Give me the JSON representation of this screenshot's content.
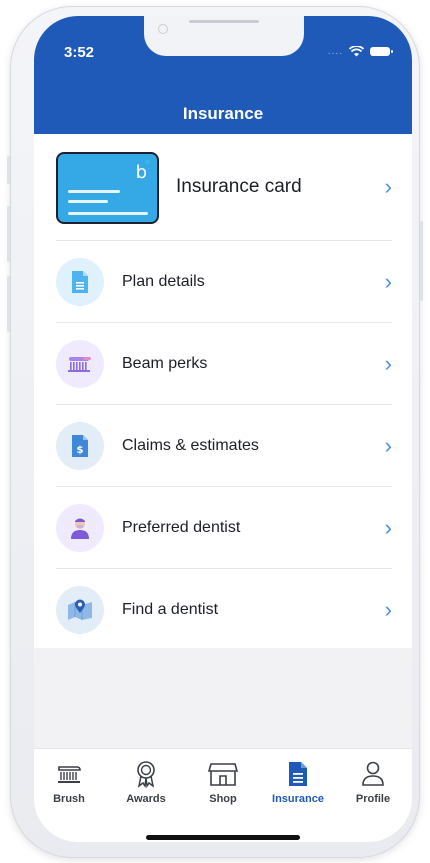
{
  "status": {
    "time": "3:52"
  },
  "header": {
    "title": "Insurance"
  },
  "card": {
    "label": "Insurance card",
    "logo_letter": "b"
  },
  "list": {
    "items": [
      {
        "label": "Plan details",
        "icon": "document-icon"
      },
      {
        "label": "Beam perks",
        "icon": "toothbrush-icon"
      },
      {
        "label": "Claims & estimates",
        "icon": "receipt-dollar-icon"
      },
      {
        "label": "Preferred dentist",
        "icon": "dentist-icon"
      },
      {
        "label": "Find a dentist",
        "icon": "map-pin-icon"
      }
    ],
    "chevron": "›"
  },
  "tabbar": {
    "tabs": [
      {
        "label": "Brush",
        "icon": "toothbrush-icon"
      },
      {
        "label": "Awards",
        "icon": "award-ribbon-icon"
      },
      {
        "label": "Shop",
        "icon": "storefront-icon"
      },
      {
        "label": "Insurance",
        "icon": "document-icon",
        "active": true
      },
      {
        "label": "Profile",
        "icon": "person-icon"
      }
    ]
  },
  "colors": {
    "header": "#1f5ab8",
    "accent": "#4a90d9",
    "card": "#35a9e6",
    "active_tab": "#1f5ab8"
  }
}
